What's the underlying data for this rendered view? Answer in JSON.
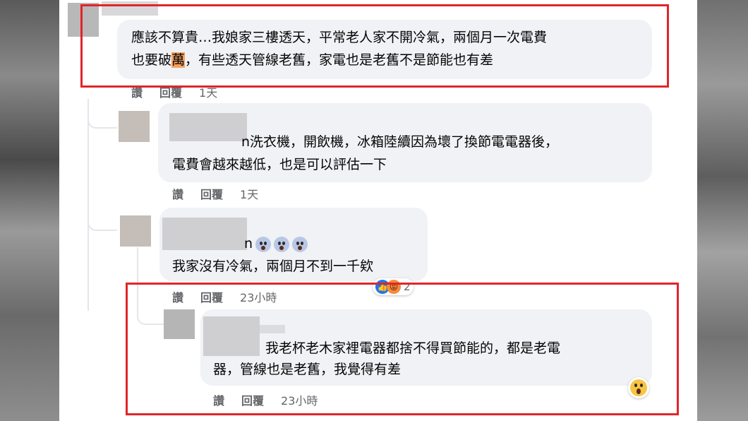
{
  "comments": [
    {
      "text_line1": "應該不算貴…我娘家三樓透天，平常老人家不開冷氣，兩個月一次電費",
      "text_line2_before": "也要破",
      "text_line2_highlight": "萬",
      "text_line2_after": "，有些透天管線老舊，家電也是老舊不是節能也有差",
      "like": "讚",
      "reply": "回覆",
      "time": "1天"
    },
    {
      "name_tail": "n",
      "text_line1": "洗衣機，開飲機，冰箱陸續因為壞了換節電電器後，",
      "text_line2": "電費會越來越低，也是可以評估一下",
      "like": "讚",
      "reply": "回覆",
      "time": "1天"
    },
    {
      "name_tail": "n",
      "text": "我家沒有冷氣，兩個月不到一千欸",
      "reaction_count": "2",
      "like": "讚",
      "reply": "回覆",
      "time": "23小時"
    },
    {
      "text_line1": "我老杯老木家裡電器都捨不得買節能的，都是老電",
      "text_line2": "器，管線也是老舊，我覺得有差",
      "like": "讚",
      "reply": "回覆",
      "time": "23小時"
    }
  ],
  "colors": {
    "highlight_box": "#e0252b",
    "bubble": "#f0f2f5",
    "meta_text": "#65676b"
  }
}
